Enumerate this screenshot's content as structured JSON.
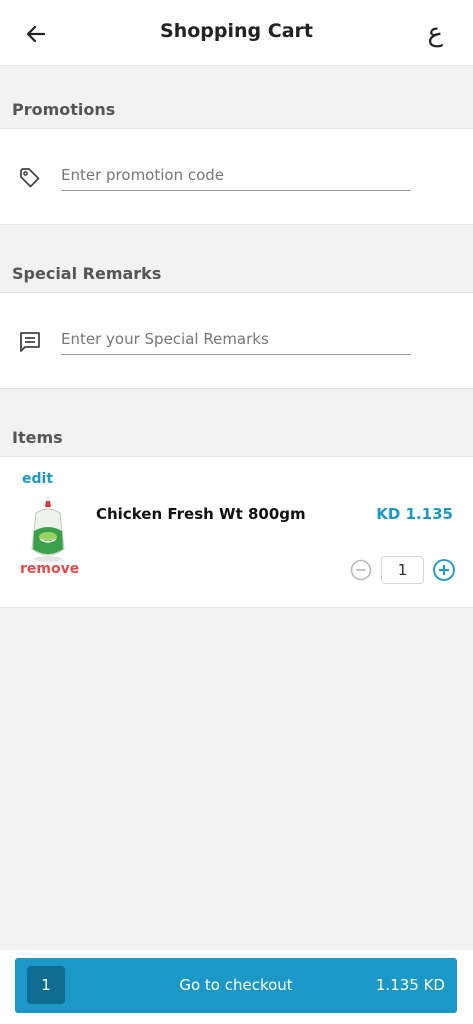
{
  "header": {
    "title": "Shopping Cart",
    "language_toggle": "ع",
    "back_icon": "arrow-left-icon"
  },
  "promotions": {
    "label": "Promotions",
    "icon": "tag-icon",
    "placeholder": "Enter promotion code",
    "value": ""
  },
  "remarks": {
    "label": "Special Remarks",
    "icon": "comment-icon",
    "placeholder": "Enter your Special Remarks",
    "value": ""
  },
  "items": {
    "label": "Items",
    "list": [
      {
        "edit_label": "edit",
        "remove_label": "remove",
        "name": "Chicken Fresh Wt 800gm",
        "price": "KD 1.135",
        "quantity": "1",
        "image_icon": "chicken-product-icon"
      }
    ]
  },
  "checkout": {
    "count": "1",
    "label": "Go to checkout",
    "total": "1.135 KD"
  },
  "colors": {
    "accent": "#1b98c7",
    "accent_dark": "#0e6c91",
    "danger": "#e64a4a",
    "background": "#f2f2f2"
  }
}
